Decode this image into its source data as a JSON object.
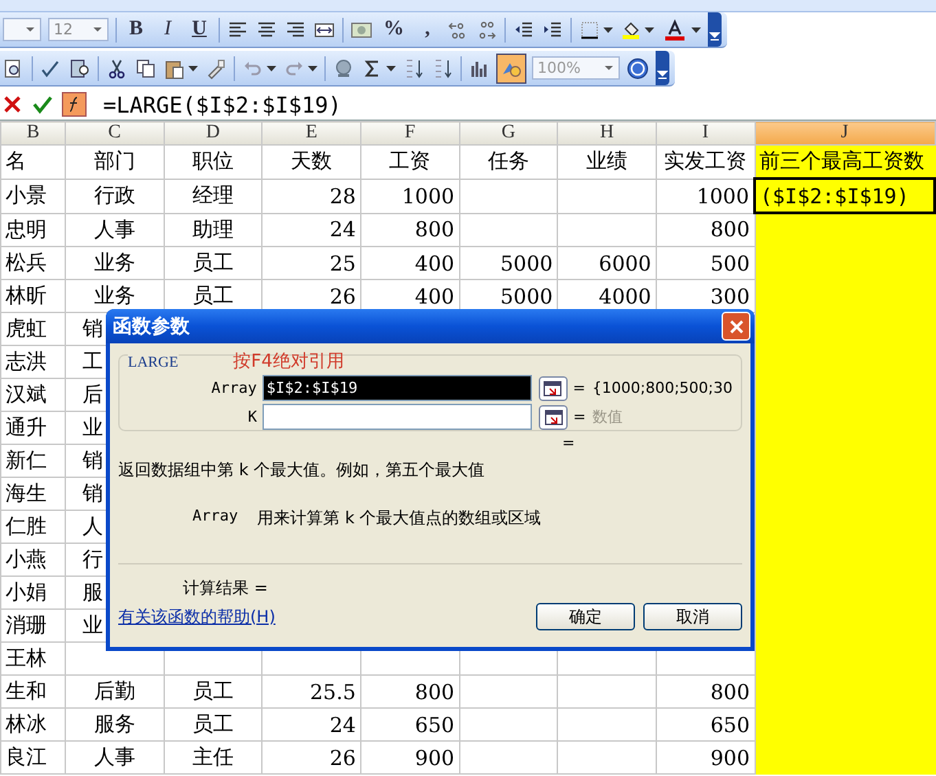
{
  "toolbars": [
    {
      "items": [
        {
          "kind": "combo",
          "value": ""
        },
        {
          "kind": "combo",
          "value": "12"
        },
        {
          "kind": "sep"
        },
        {
          "kind": "letter",
          "text": "B"
        },
        {
          "kind": "letter",
          "text": "I"
        },
        {
          "kind": "letter",
          "text": "U"
        },
        {
          "kind": "sep"
        },
        {
          "kind": "align-left"
        },
        {
          "kind": "align-center"
        },
        {
          "kind": "align-right"
        },
        {
          "kind": "merge"
        },
        {
          "kind": "sep"
        },
        {
          "kind": "currency"
        },
        {
          "kind": "letter",
          "text": "%"
        },
        {
          "kind": "letter",
          "text": ","
        },
        {
          "kind": "inc-decimal"
        },
        {
          "kind": "dec-decimal"
        },
        {
          "kind": "sep"
        },
        {
          "kind": "outdent"
        },
        {
          "kind": "indent"
        },
        {
          "kind": "sep"
        },
        {
          "kind": "borders"
        },
        {
          "kind": "caret"
        },
        {
          "kind": "fill-color"
        },
        {
          "kind": "caret"
        },
        {
          "kind": "font-color"
        },
        {
          "kind": "caret"
        },
        {
          "kind": "more"
        }
      ]
    },
    {
      "items": [
        {
          "kind": "preview",
          "pressed": false
        },
        {
          "kind": "sep"
        },
        {
          "kind": "spelling",
          "pressed": false
        },
        {
          "kind": "research",
          "pressed": false
        },
        {
          "kind": "sep"
        },
        {
          "kind": "cut",
          "pressed": false
        },
        {
          "kind": "copy",
          "pressed": false
        },
        {
          "kind": "paste",
          "pressed": false
        },
        {
          "kind": "caret"
        },
        {
          "kind": "painter",
          "pressed": false
        },
        {
          "kind": "sep"
        },
        {
          "kind": "undo",
          "pressed": false
        },
        {
          "kind": "caret"
        },
        {
          "kind": "redo",
          "pressed": false
        },
        {
          "kind": "caret"
        },
        {
          "kind": "sep"
        },
        {
          "kind": "hyperlink",
          "pressed": false
        },
        {
          "kind": "sum",
          "pressed": false
        },
        {
          "kind": "caret"
        },
        {
          "kind": "sort-asc",
          "pressed": false
        },
        {
          "kind": "sort-desc",
          "pressed": false
        },
        {
          "kind": "sep"
        },
        {
          "kind": "chart",
          "pressed": false
        },
        {
          "kind": "drawing",
          "pressed": true
        },
        {
          "kind": "zoom",
          "value": "100%"
        },
        {
          "kind": "help",
          "pressed": false
        },
        {
          "kind": "more"
        }
      ]
    }
  ],
  "formula_bar": {
    "formula": "=LARGE($I$2:$I$19)"
  },
  "table": {
    "columns": [
      {
        "label": "B",
        "selected": false
      },
      {
        "label": "C",
        "selected": false
      },
      {
        "label": "D",
        "selected": false
      },
      {
        "label": "E",
        "selected": false
      },
      {
        "label": "F",
        "selected": false
      },
      {
        "label": "G",
        "selected": false
      },
      {
        "label": "H",
        "selected": false
      },
      {
        "label": "I",
        "selected": false
      },
      {
        "label": "J",
        "selected": true
      }
    ],
    "rows": [
      {
        "cells": [
          "名",
          "部门",
          "职位",
          "天数",
          "工资",
          "任务",
          "业绩",
          "实发工资"
        ],
        "column_j": {
          "text": "前三个最高工资数",
          "selected": false
        }
      },
      {
        "cells": [
          "小景",
          "行政",
          "经理",
          "28",
          "1000",
          "",
          "",
          "1000"
        ],
        "column_j": {
          "text": "($I$2:$I$19)",
          "selected": true
        }
      },
      {
        "cells": [
          "忠明",
          "人事",
          "助理",
          "24",
          "800",
          "",
          "",
          "800"
        ],
        "column_j": {
          "selected": false
        }
      },
      {
        "cells": [
          "松兵",
          "业务",
          "员工",
          "25",
          "400",
          "5000",
          "6000",
          "500"
        ],
        "column_j": {
          "selected": false
        }
      },
      {
        "cells": [
          "林昕",
          "业务",
          "员工",
          "26",
          "400",
          "5000",
          "4000",
          "300"
        ],
        "column_j": {
          "selected": false
        }
      },
      {
        "cells": [
          "虎虹",
          "销"
        ],
        "column_j": {
          "selected": false
        }
      },
      {
        "cells": [
          "志洪",
          "工"
        ],
        "column_j": {
          "selected": false
        }
      },
      {
        "cells": [
          "汉斌",
          "后"
        ],
        "column_j": {
          "selected": false
        }
      },
      {
        "cells": [
          "通升",
          "业"
        ],
        "column_j": {
          "selected": false
        }
      },
      {
        "cells": [
          "新仁",
          "销"
        ],
        "column_j": {
          "selected": false
        }
      },
      {
        "cells": [
          "海生",
          "销"
        ],
        "column_j": {
          "selected": false
        }
      },
      {
        "cells": [
          "仁胜",
          "人"
        ],
        "column_j": {
          "selected": false
        }
      },
      {
        "cells": [
          "小燕",
          "行"
        ],
        "column_j": {
          "selected": false
        }
      },
      {
        "cells": [
          "小娟",
          "服"
        ],
        "column_j": {
          "selected": false
        }
      },
      {
        "cells": [
          "消珊",
          "业"
        ],
        "column_j": {
          "selected": false
        }
      },
      {
        "cells": [
          "王林"
        ],
        "column_j": {
          "selected": false
        }
      },
      {
        "cells": [
          "生和",
          "后勤",
          "员工",
          "25.5",
          "800",
          "",
          "",
          "800"
        ],
        "column_j": {
          "selected": false
        }
      },
      {
        "cells": [
          "林冰",
          "服务",
          "员工",
          "24",
          "650",
          "",
          "",
          "650"
        ],
        "column_j": {
          "selected": false
        }
      },
      {
        "cells": [
          "良江",
          "人事",
          "主任",
          "26",
          "900",
          "",
          "",
          "900"
        ],
        "column_j": {
          "selected": false
        }
      }
    ]
  },
  "dialog": {
    "title": "函数参数",
    "function_name": "LARGE",
    "hint": "按F4绝对引用",
    "arguments": [
      {
        "label": "Array",
        "value": "$I$2:$I$19",
        "selected": true,
        "equals": "=",
        "result": "{1000;800;500;30"
      },
      {
        "label": "K",
        "selected": false,
        "equals": "=",
        "result": "数值"
      }
    ],
    "function_result": "=",
    "description": "返回数据组中第 k 个最大值。例如，第五个最大值",
    "argument_help": {
      "name": "Array",
      "text": "用来计算第 k 个最大值点的数组或区域"
    },
    "formula_result": "计算结果 =",
    "help_link": "有关该函数的帮助(H)",
    "buttons": [
      "确定",
      "取消"
    ]
  }
}
